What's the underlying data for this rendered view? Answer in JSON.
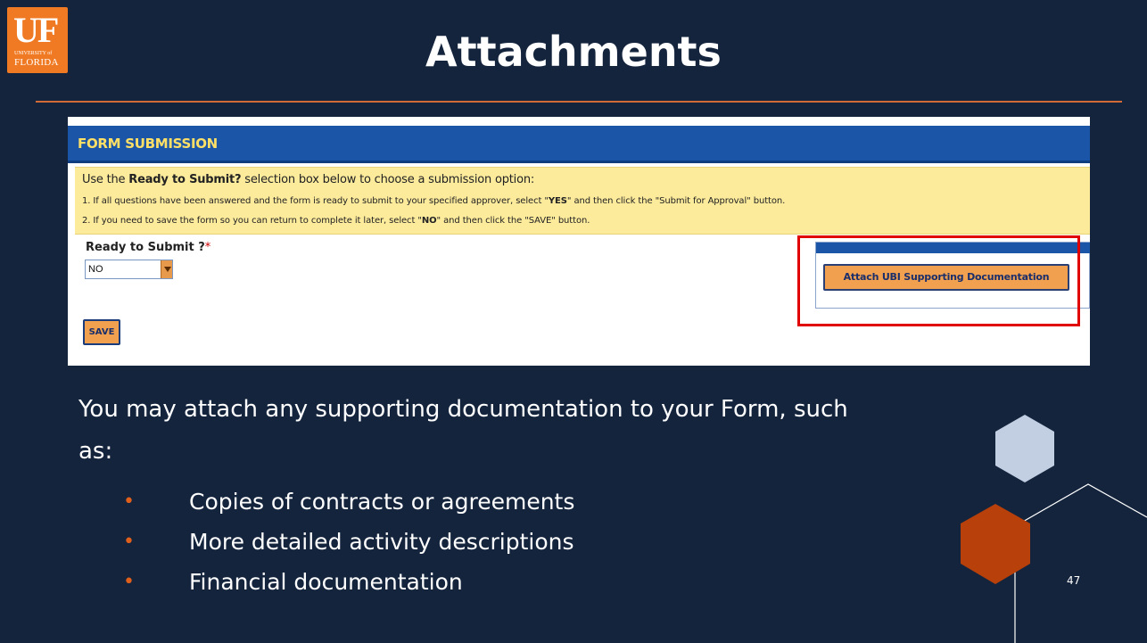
{
  "logo": {
    "mark": "UF",
    "univ": "UNIVERSITY of",
    "name": "FLORIDA"
  },
  "title": "Attachments",
  "form": {
    "header": "FORM SUBMISSION",
    "instructions": {
      "line1_pre": "Use the ",
      "line1_bold": "Ready to Submit?",
      "line1_post": " selection box below to choose a submission option:",
      "line2_pre": "1. If all questions have been answered and the form is ready to submit to your specified approver, select \"",
      "line2_bold": "YES",
      "line2_post": "\" and then click the \"Submit for Approval\" button.",
      "line3_pre": "2. If you need to save the form so you can return to complete it later, select \"",
      "line3_bold": "NO",
      "line3_post": "\" and then click the \"SAVE\" button."
    },
    "ready_label": "Ready to Submit ?",
    "required_mark": "*",
    "ready_value": "NO",
    "save_label": "SAVE",
    "attach_label": "Attach UBI Supporting Documentation"
  },
  "body": {
    "intro": "You may attach any supporting documentation to your Form, such as:",
    "bullets": [
      "Copies of contracts or agreements",
      "More detailed activity descriptions",
      "Financial documentation"
    ],
    "bullet_glyph": "•"
  },
  "page_number": "47",
  "colors": {
    "background": "#14243d",
    "accent_orange": "#f07a23",
    "divider": "#d16a36",
    "hex_light": "#c2cfe3",
    "hex_dark": "#b8400a",
    "highlight_box": "#e00000"
  }
}
